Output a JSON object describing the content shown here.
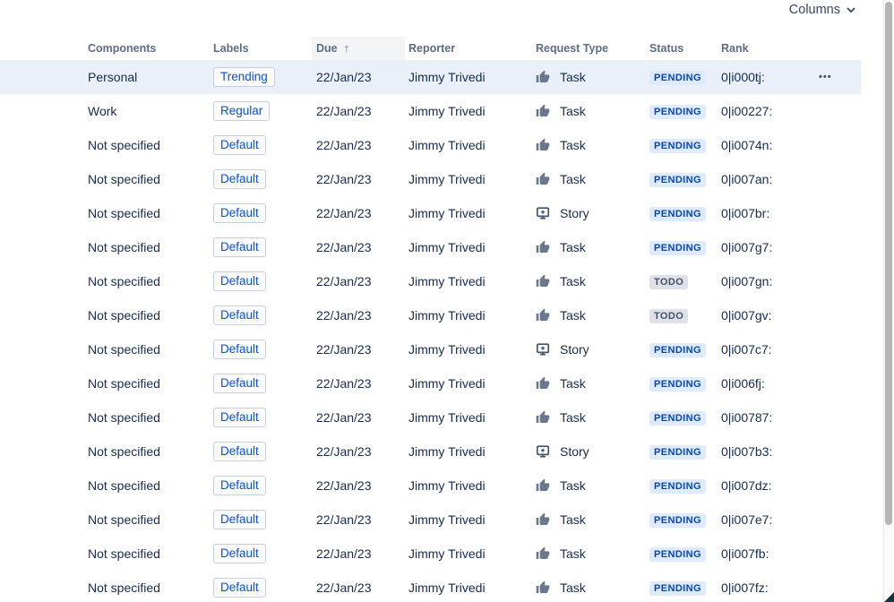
{
  "toolbar": {
    "columns_label": "Columns"
  },
  "icons": {
    "sort_arrow": "↑",
    "more_actions": "•••"
  },
  "table": {
    "headers": [
      {
        "label": "Components"
      },
      {
        "label": "Labels"
      },
      {
        "label": "Due",
        "sorted": "ascending"
      },
      {
        "label": "Reporter"
      },
      {
        "label": "Request Type"
      },
      {
        "label": "Status"
      },
      {
        "label": "Rank"
      }
    ],
    "rows": [
      {
        "components": "Personal",
        "label": "Trending",
        "due": "22/Jan/23",
        "reporter": "Jimmy Trivedi",
        "request_type": "Task",
        "request_icon": "thumbs-up",
        "status": "PENDING",
        "status_kind": "pending",
        "rank": "0|i000tj:",
        "selected": true,
        "has_actions": true
      },
      {
        "components": "Work",
        "label": "Regular",
        "due": "22/Jan/23",
        "reporter": "Jimmy Trivedi",
        "request_type": "Task",
        "request_icon": "thumbs-up",
        "status": "PENDING",
        "status_kind": "pending",
        "rank": "0|i00227:",
        "selected": false,
        "has_actions": false
      },
      {
        "components": "Not specified",
        "label": "Default",
        "due": "22/Jan/23",
        "reporter": "Jimmy Trivedi",
        "request_type": "Task",
        "request_icon": "thumbs-up",
        "status": "PENDING",
        "status_kind": "pending",
        "rank": "0|i0074n:",
        "selected": false,
        "has_actions": false
      },
      {
        "components": "Not specified",
        "label": "Default",
        "due": "22/Jan/23",
        "reporter": "Jimmy Trivedi",
        "request_type": "Task",
        "request_icon": "thumbs-up",
        "status": "PENDING",
        "status_kind": "pending",
        "rank": "0|i007an:",
        "selected": false,
        "has_actions": false
      },
      {
        "components": "Not specified",
        "label": "Default",
        "due": "22/Jan/23",
        "reporter": "Jimmy Trivedi",
        "request_type": "Story",
        "request_icon": "story-monitor",
        "status": "PENDING",
        "status_kind": "pending",
        "rank": "0|i007br:",
        "selected": false,
        "has_actions": false
      },
      {
        "components": "Not specified",
        "label": "Default",
        "due": "22/Jan/23",
        "reporter": "Jimmy Trivedi",
        "request_type": "Task",
        "request_icon": "thumbs-up",
        "status": "PENDING",
        "status_kind": "pending",
        "rank": "0|i007g7:",
        "selected": false,
        "has_actions": false
      },
      {
        "components": "Not specified",
        "label": "Default",
        "due": "22/Jan/23",
        "reporter": "Jimmy Trivedi",
        "request_type": "Task",
        "request_icon": "thumbs-up",
        "status": "TODO",
        "status_kind": "todo",
        "rank": "0|i007gn:",
        "selected": false,
        "has_actions": false
      },
      {
        "components": "Not specified",
        "label": "Default",
        "due": "22/Jan/23",
        "reporter": "Jimmy Trivedi",
        "request_type": "Task",
        "request_icon": "thumbs-up",
        "status": "TODO",
        "status_kind": "todo",
        "rank": "0|i007gv:",
        "selected": false,
        "has_actions": false
      },
      {
        "components": "Not specified",
        "label": "Default",
        "due": "22/Jan/23",
        "reporter": "Jimmy Trivedi",
        "request_type": "Story",
        "request_icon": "story-monitor",
        "status": "PENDING",
        "status_kind": "pending",
        "rank": "0|i007c7:",
        "selected": false,
        "has_actions": false
      },
      {
        "components": "Not specified",
        "label": "Default",
        "due": "22/Jan/23",
        "reporter": "Jimmy Trivedi",
        "request_type": "Task",
        "request_icon": "thumbs-up",
        "status": "PENDING",
        "status_kind": "pending",
        "rank": "0|i006fj:",
        "selected": false,
        "has_actions": false
      },
      {
        "components": "Not specified",
        "label": "Default",
        "due": "22/Jan/23",
        "reporter": "Jimmy Trivedi",
        "request_type": "Task",
        "request_icon": "thumbs-up",
        "status": "PENDING",
        "status_kind": "pending",
        "rank": "0|i00787:",
        "selected": false,
        "has_actions": false
      },
      {
        "components": "Not specified",
        "label": "Default",
        "due": "22/Jan/23",
        "reporter": "Jimmy Trivedi",
        "request_type": "Story",
        "request_icon": "story-monitor",
        "status": "PENDING",
        "status_kind": "pending",
        "rank": "0|i007b3:",
        "selected": false,
        "has_actions": false
      },
      {
        "components": "Not specified",
        "label": "Default",
        "due": "22/Jan/23",
        "reporter": "Jimmy Trivedi",
        "request_type": "Task",
        "request_icon": "thumbs-up",
        "status": "PENDING",
        "status_kind": "pending",
        "rank": "0|i007dz:",
        "selected": false,
        "has_actions": false
      },
      {
        "components": "Not specified",
        "label": "Default",
        "due": "22/Jan/23",
        "reporter": "Jimmy Trivedi",
        "request_type": "Task",
        "request_icon": "thumbs-up",
        "status": "PENDING",
        "status_kind": "pending",
        "rank": "0|i007e7:",
        "selected": false,
        "has_actions": false
      },
      {
        "components": "Not specified",
        "label": "Default",
        "due": "22/Jan/23",
        "reporter": "Jimmy Trivedi",
        "request_type": "Task",
        "request_icon": "thumbs-up",
        "status": "PENDING",
        "status_kind": "pending",
        "rank": "0|i007fb:",
        "selected": false,
        "has_actions": false
      },
      {
        "components": "Not specified",
        "label": "Default",
        "due": "22/Jan/23",
        "reporter": "Jimmy Trivedi",
        "request_type": "Task",
        "request_icon": "thumbs-up",
        "status": "PENDING",
        "status_kind": "pending",
        "rank": "0|i007fz:",
        "selected": false,
        "has_actions": false
      }
    ]
  },
  "colors": {
    "accent_blue": "#0C51CF",
    "status_pending_bg": "#DEEBFF",
    "status_pending_text": "#0747A6",
    "status_todo_bg": "#DFE1E6",
    "status_todo_text": "#42526E",
    "selected_row_bg": "#E9F0F8",
    "sorted_header_bg": "#F3F4F6",
    "header_text": "#5E6C84",
    "body_text": "#172B4D"
  }
}
